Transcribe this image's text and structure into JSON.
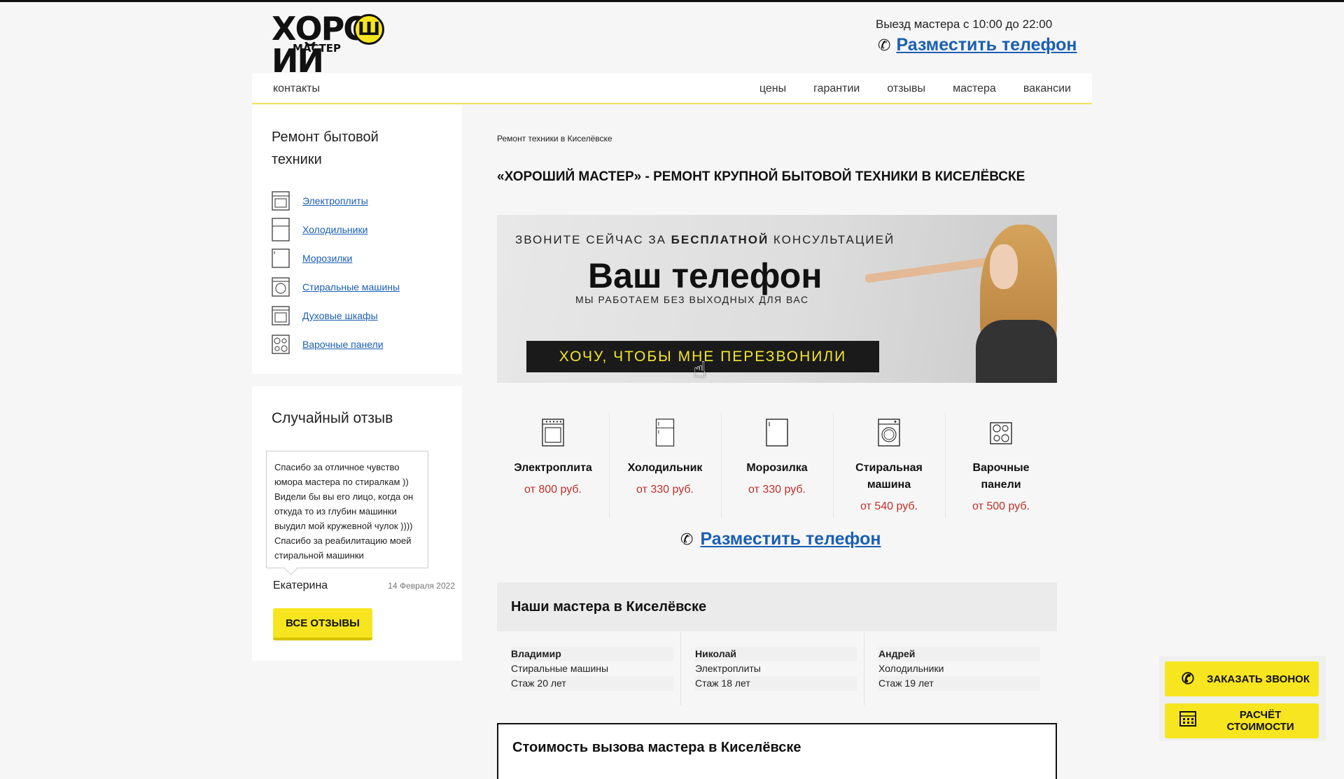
{
  "header": {
    "logo_main": "ХОРОШИЙ",
    "logo_sub": "МАСТЕР",
    "hours": "Выезд мастера с 10:00 до 22:00",
    "phone_link": "Разместить телефон"
  },
  "nav": {
    "contacts": "контакты",
    "items": [
      "цены",
      "гарантии",
      "отзывы",
      "мастера",
      "вакансии"
    ]
  },
  "sidebar": {
    "title": "Ремонт бытовой техники",
    "items": [
      "Электроплиты",
      "Холодильники",
      "Морозилки",
      "Стиральные машины",
      "Духовые шкафы",
      "Варочные панели"
    ]
  },
  "review": {
    "title": "Случайный отзыв",
    "text": "Спасибо за отличное чувство юмора мастера по стиралкам )) Видели бы вы его лицо, когда он откуда то из глубин машинки выудил мой кружевной чулок )))) Спасибо за реабилитацию моей стиральной машинки",
    "author": "Екатерина",
    "date": "14 Февраля 2022",
    "all_button": "ВСЕ ОТЗЫВЫ"
  },
  "main": {
    "breadcrumb": "Ремонт техники в Киселёвске",
    "h1": "«ХОРОШИЙ МАСТЕР» - РЕМОНТ КРУПНОЙ БЫТОВОЙ ТЕХНИКИ В КИСЕЛЁВСКЕ",
    "banner": {
      "top_a": "ЗВОНИТЕ СЕЙЧАС ЗА ",
      "top_b": "БЕСПЛАТНОЙ",
      "top_c": " КОНСУЛЬТАЦИЕЙ",
      "big": "Ваш телефон",
      "sub": "МЫ РАБОТАЕМ БЕЗ ВЫХОДНЫХ ДЛЯ ВАС",
      "button": "ХОЧУ, ЧТОБЫ МНЕ ПЕРЕЗВОНИЛИ"
    },
    "products": [
      {
        "name": "Электроплита",
        "price": "от 800 руб."
      },
      {
        "name": "Холодильник",
        "price": "от 330 руб."
      },
      {
        "name": "Морозилка",
        "price": "от 330 руб."
      },
      {
        "name": "Стиральная машина",
        "price": "от 540 руб."
      },
      {
        "name": "Варочные панели",
        "price": "от 500 руб."
      }
    ],
    "phone_link": "Разместить телефон",
    "masters_title": "Наши мастера в Киселёвске",
    "masters": [
      {
        "name": "Владимир",
        "spec": "Стиральные машины",
        "exp": "Стаж 20 лет"
      },
      {
        "name": "Николай",
        "spec": "Электроплиты",
        "exp": "Стаж 18 лет"
      },
      {
        "name": "Андрей",
        "spec": "Холодильники",
        "exp": "Стаж 19 лет"
      }
    ],
    "cost_title": "Стоимость вызова мастера в Киселёвске"
  },
  "floating": {
    "call": "ЗАКАЗАТЬ ЗВОНОК",
    "calc": "РАСЧЁТ СТОИМОСТИ"
  },
  "colors": {
    "accent_yellow": "#f7e51f",
    "link_blue": "#1a5fb4",
    "price_red": "#c0302a"
  }
}
